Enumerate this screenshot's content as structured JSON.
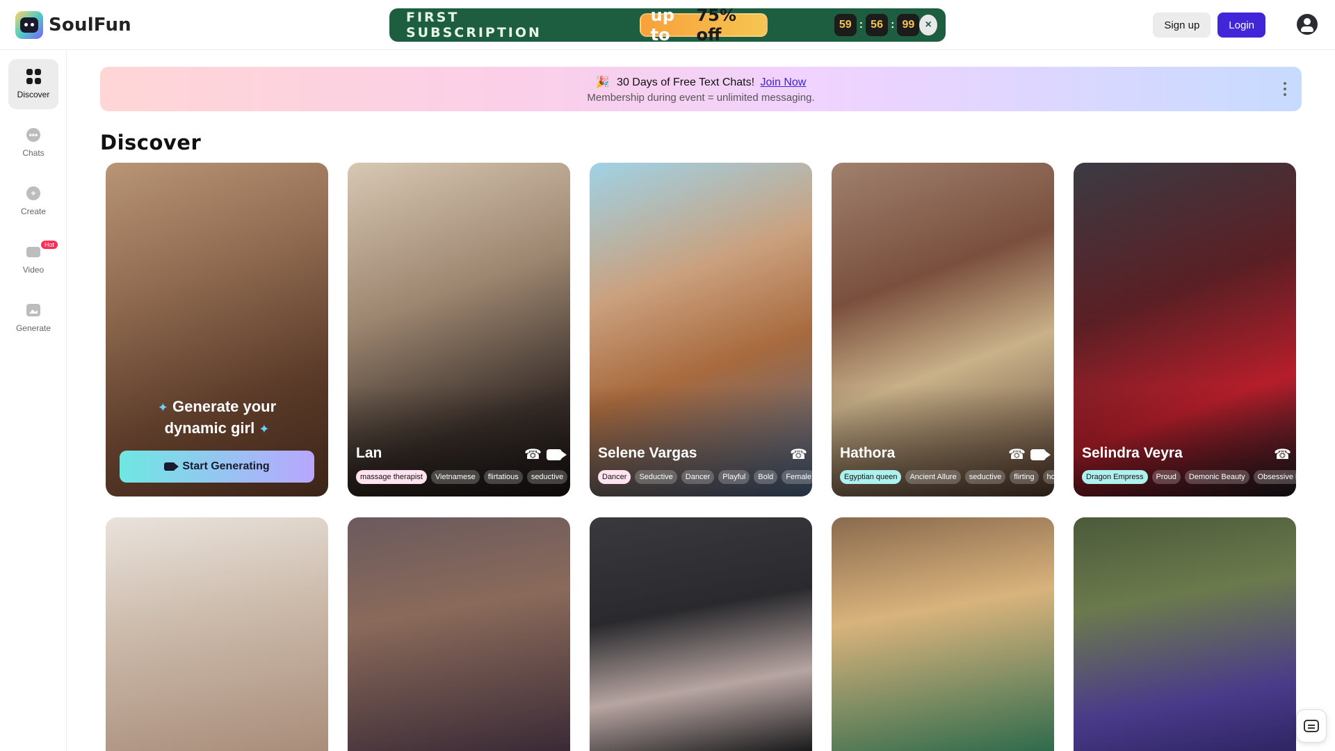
{
  "header": {
    "brand": "SoulFun",
    "promo": {
      "title": "FIRST SUBSCRIPTION",
      "offer_prefix": "up to",
      "offer_value": "75% off",
      "timer": [
        "59",
        "56",
        "99"
      ],
      "timer_sep": ":",
      "close": "×"
    },
    "signup_label": "Sign up",
    "login_label": "Login"
  },
  "sidebar": {
    "items": [
      {
        "label": "Discover"
      },
      {
        "label": "Chats"
      },
      {
        "label": "Create"
      },
      {
        "label": "Video",
        "badge": "Hot"
      },
      {
        "label": "Generate"
      }
    ]
  },
  "banner": {
    "emoji": "🎉",
    "line1": "30 Days of Free Text Chats!",
    "link": "Join Now",
    "line2": "Membership during event = unlimited messaging."
  },
  "section_title": "Discover",
  "generate_card": {
    "title": "Generate your dynamic girl",
    "sparkle": "✦",
    "button_label": "Start Generating"
  },
  "cards": [
    {
      "name": "Lan",
      "video": true,
      "tags": [
        "massage therapist",
        "Vietnamese",
        "flirtatious",
        "seductive"
      ],
      "first_tag_style": "pink"
    },
    {
      "name": "Selene Vargas",
      "video": false,
      "tags": [
        "Dancer",
        "Seductive",
        "Dancer",
        "Playful",
        "Bold",
        "Female"
      ],
      "first_tag_style": "pink"
    },
    {
      "name": "Hathora",
      "video": true,
      "tags": [
        "Egyptian queen",
        "Ancient Allure",
        "seductive",
        "flirting",
        "ho"
      ],
      "first_tag_style": "cyan"
    },
    {
      "name": "Selindra Veyra",
      "video": false,
      "tags": [
        "Dragon Empress",
        "Proud",
        "Demonic Beauty",
        "Obsessive l"
      ],
      "first_tag_style": "cyan"
    }
  ],
  "colors": {
    "brand_purple": "#4126d9",
    "promo_green": "#1d5e41",
    "hot_badge": "#ff2d55"
  }
}
